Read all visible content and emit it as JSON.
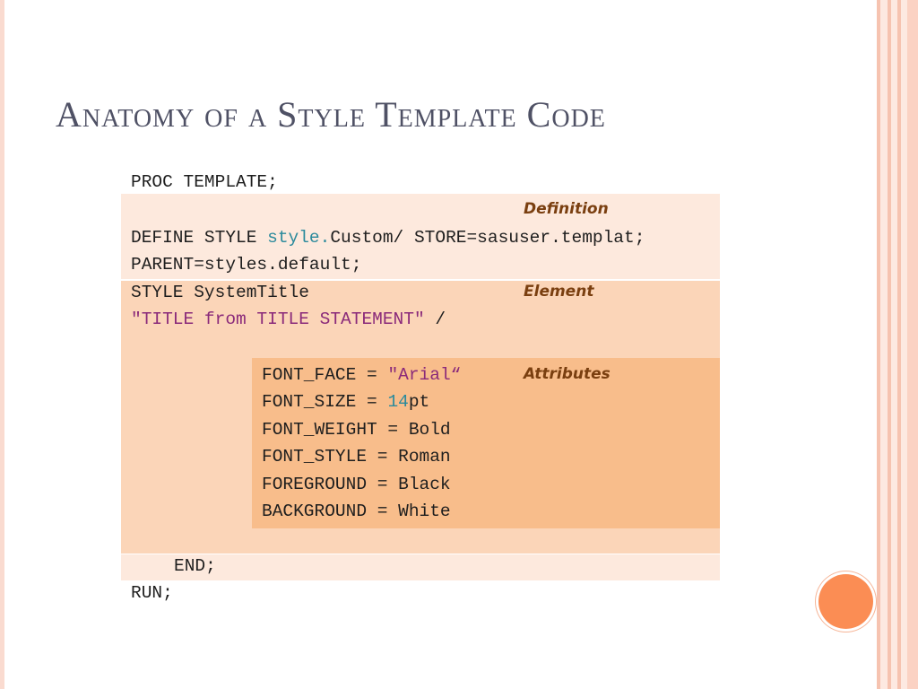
{
  "slide": {
    "title": "Anatomy of a Style Template Code"
  },
  "code": {
    "line1": "PROC TEMPLATE;",
    "define_prefix": "DEFINE STYLE ",
    "define_style_word": "style.",
    "define_suffix": "Custom/ STORE=sasuser.templat;",
    "parent": "PARENT=styles.default;",
    "style_line": "STYLE SystemTitle",
    "title_string": "\"TITLE from TITLE STATEMENT\"",
    "title_slash": " /",
    "font_face_prefix": "FONT_FACE = ",
    "font_face_value": "\"Arial“",
    "font_size_prefix": "FONT_SIZE = ",
    "font_size_value": "14",
    "font_size_unit": "pt",
    "font_weight": "FONT_WEIGHT = Bold",
    "font_style": "FONT_STYLE = Roman",
    "foreground": "FOREGROUND = Black",
    "background": "BACKGROUND = White",
    "end": "END;",
    "run": "RUN;"
  },
  "labels": {
    "definition": "Definition",
    "element": "Element",
    "attributes": "Attributes"
  },
  "colors": {
    "title_text": "#4f5165",
    "definition_band": "#fde9dd",
    "element_band": "#fbd5b8",
    "attributes_band": "#f8bd8b",
    "accent_circle": "#fb8d54"
  }
}
